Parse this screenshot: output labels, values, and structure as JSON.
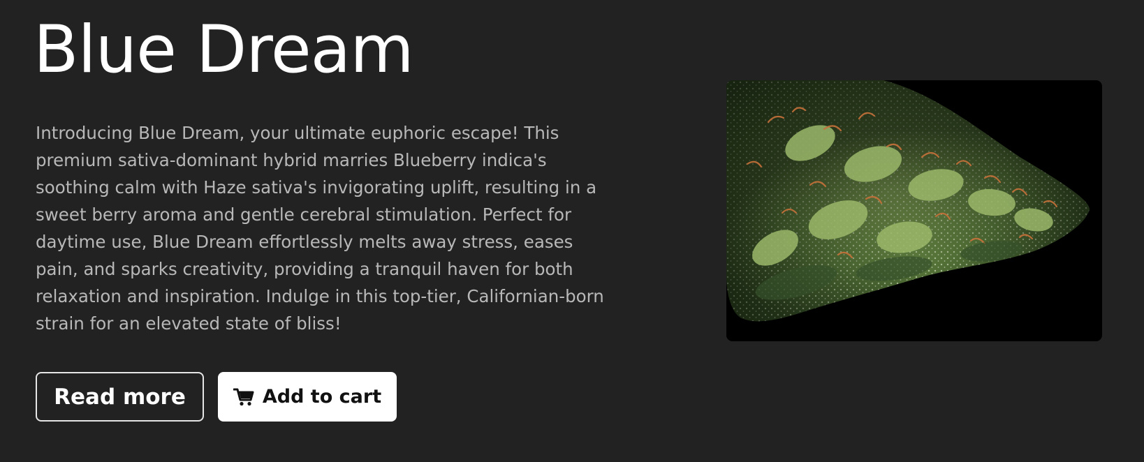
{
  "product": {
    "title": "Blue Dream",
    "description": "Introducing Blue Dream, your ultimate euphoric escape! This premium sativa-dominant hybrid marries Blueberry indica's soothing calm with Haze sativa's invigorating uplift, resulting in a sweet berry aroma and gentle cerebral stimulation. Perfect for daytime use, Blue Dream effortlessly melts away stress, eases pain, and sparks creativity, providing a tranquil haven for both relaxation and inspiration. Indulge in this top-tier, Californian-born strain for an elevated state of bliss!"
  },
  "actions": {
    "read_more_label": "Read more",
    "add_to_cart_label": "Add to cart",
    "add_to_cart_icon": "cart-icon"
  },
  "colors": {
    "background": "#222222",
    "title": "#ffffff",
    "description": "#b8b8b8",
    "button_solid_bg": "#ffffff",
    "button_outline_border": "#e6e6e6"
  }
}
